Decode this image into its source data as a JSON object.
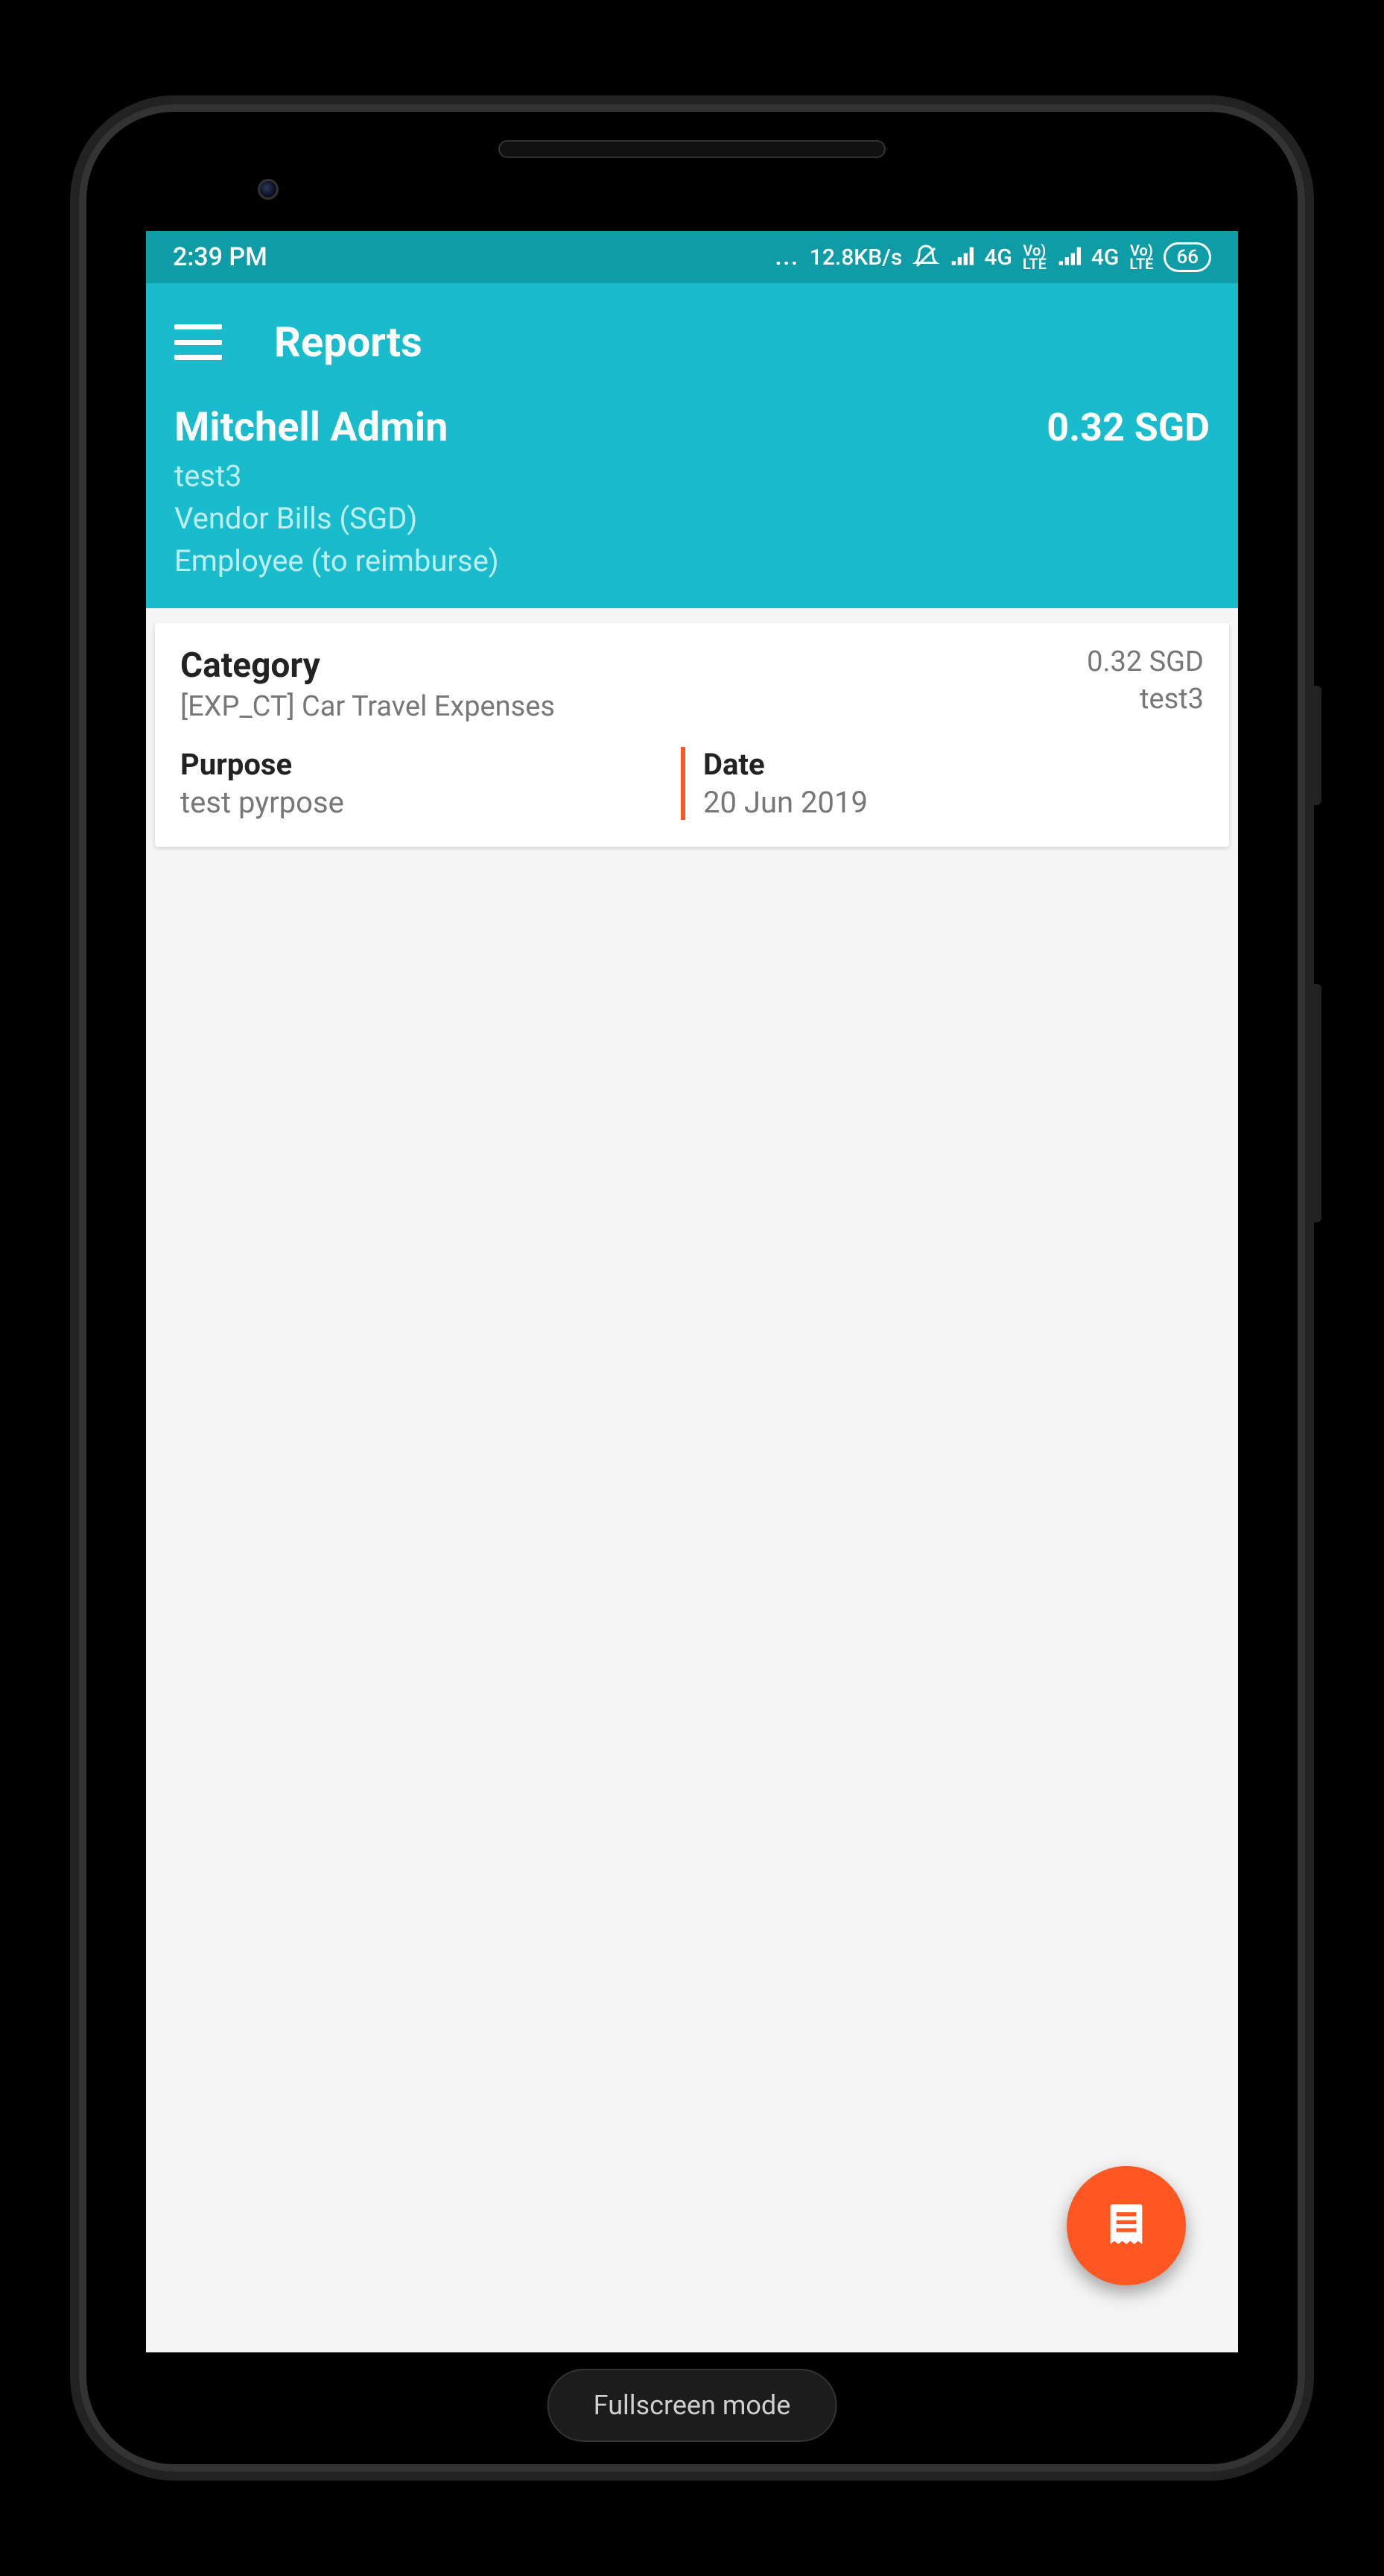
{
  "statusbar": {
    "time": "2:39 PM",
    "dots": "...",
    "data_rate": "12.8KB/s",
    "net1_type": "4G",
    "net1_volte_top": "Vo)",
    "net1_volte_bot": "LTE",
    "net2_type": "4G",
    "net2_volte_top": "Vo)",
    "net2_volte_bot": "LTE",
    "battery": "66"
  },
  "appbar": {
    "title": "Reports"
  },
  "header": {
    "name": "Mitchell Admin",
    "amount": "0.32 SGD",
    "line1": "test3",
    "line2": "Vendor Bills (SGD)",
    "line3": "Employee (to reimburse)"
  },
  "card": {
    "category_label": "Category",
    "category_value": "[EXP_CT] Car Travel Expenses",
    "amount": "0.32 SGD",
    "ref": "test3",
    "purpose_label": "Purpose",
    "purpose_value": "test pyrpose",
    "date_label": "Date",
    "date_value": "20 Jun 2019"
  },
  "home_button": {
    "label": "Fullscreen mode"
  },
  "colors": {
    "primary": "#18bccc",
    "primary_dark": "#0e9ca7",
    "accent": "#ff5722"
  }
}
